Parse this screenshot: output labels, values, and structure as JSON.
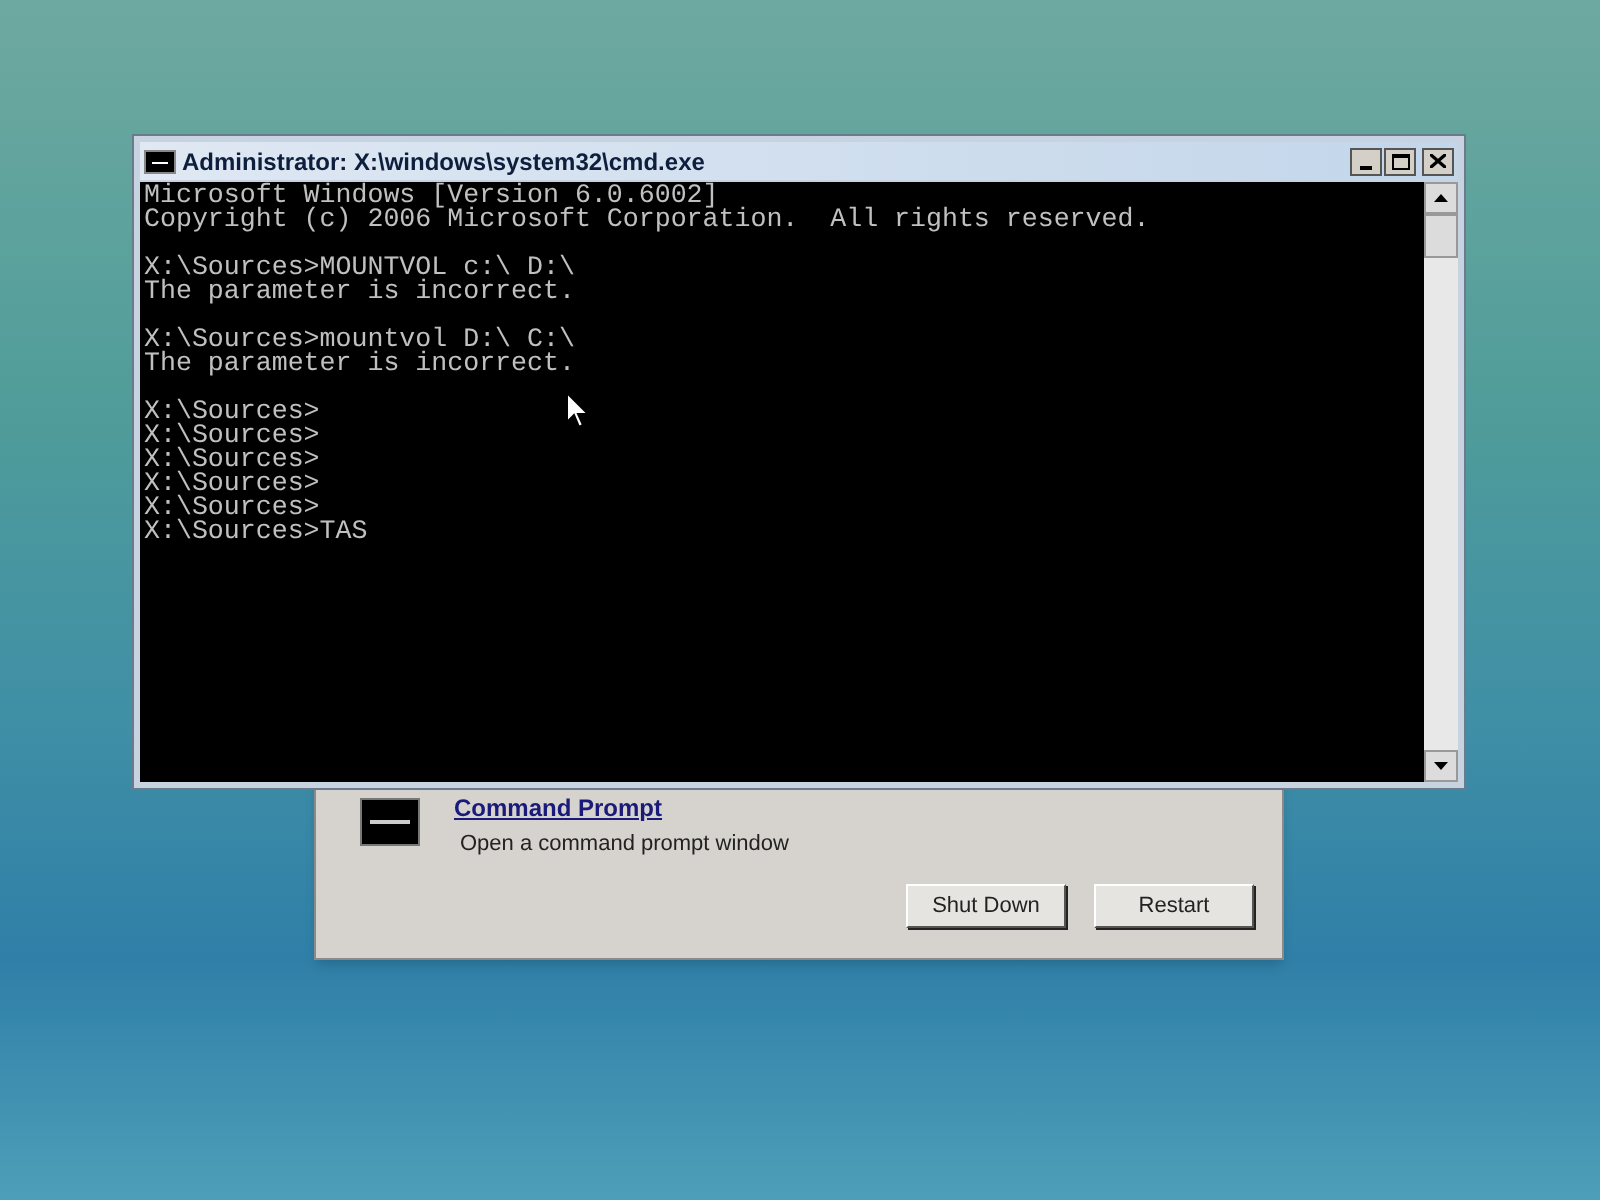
{
  "console_window": {
    "title": "Administrator: X:\\windows\\system32\\cmd.exe",
    "blocks": [
      [
        "Microsoft Windows [Version 6.0.6002]",
        "Copyright (c) 2006 Microsoft Corporation.  All rights reserved."
      ],
      [
        "X:\\Sources>MOUNTVOL c:\\ D:\\",
        "The parameter is incorrect."
      ],
      [
        "X:\\Sources>mountvol D:\\ C:\\",
        "The parameter is incorrect."
      ],
      [
        "X:\\Sources>",
        "X:\\Sources>",
        "X:\\Sources>",
        "X:\\Sources>",
        "X:\\Sources>",
        "X:\\Sources>TAS"
      ]
    ]
  },
  "recovery_dialog": {
    "tool": {
      "title": "Command Prompt",
      "description": "Open a command prompt window"
    },
    "buttons": [
      "Shut Down",
      "Restart"
    ]
  }
}
